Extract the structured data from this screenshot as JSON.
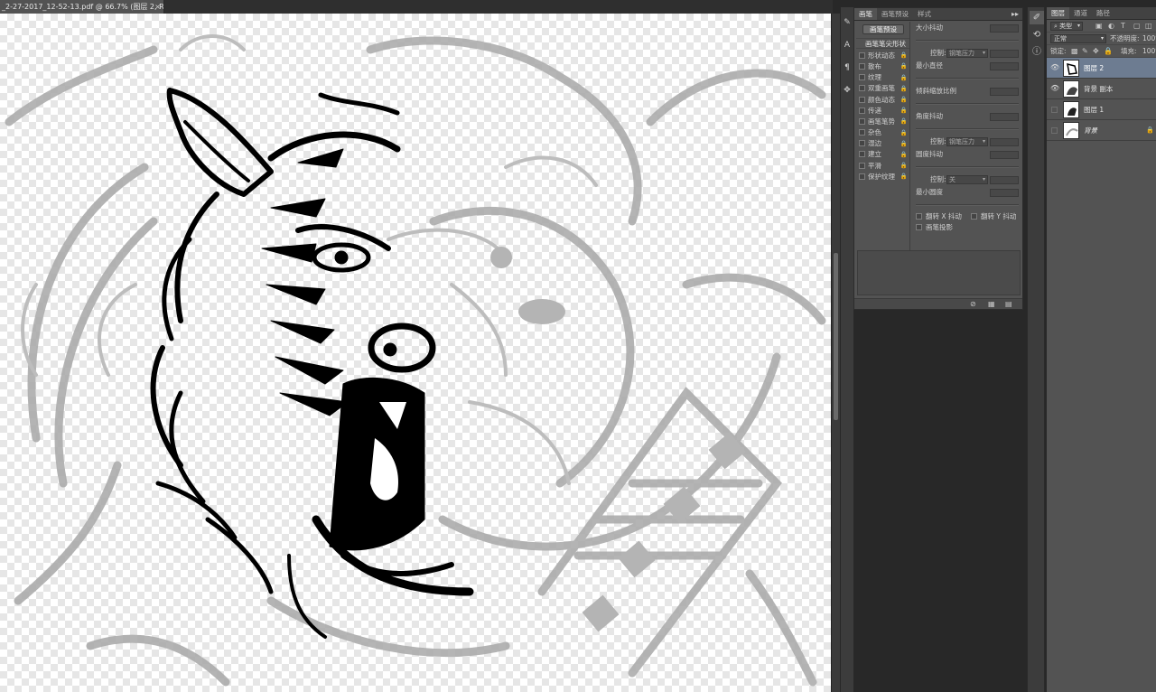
{
  "document": {
    "tab_title": "_2-27-2017_12-52-13.pdf @ 66.7% (图层 2, RGB/8#) *",
    "close_glyph": "×"
  },
  "brush_panel": {
    "tabs": [
      "画笔",
      "画笔预设",
      "样式"
    ],
    "menu_glyph": "▸▸",
    "preset_button": "画笔预设",
    "tip_shape": "画笔笔尖形状",
    "options": [
      "形状动态",
      "散布",
      "纹理",
      "双重画笔",
      "颜色动态",
      "传递",
      "画笔笔势",
      "杂色",
      "湿边",
      "建立",
      "平滑",
      "保护纹理"
    ],
    "size_jitter": "大小抖动",
    "control_label": "控制:",
    "control_pen_pressure": "钢笔压力",
    "control_off": "关",
    "min_diameter": "最小直径",
    "tilt_scale": "倾斜缩放比例",
    "angle_jitter": "角度抖动",
    "roundness_jitter": "圆度抖动",
    "min_roundness": "最小圆度",
    "flip_x": "翻转 X 抖动",
    "flip_y": "翻转 Y 抖动",
    "brush_projection": "画笔投影"
  },
  "layers_panel": {
    "tabs": [
      "图层",
      "通道",
      "路径"
    ],
    "filter_kind": "类型",
    "blend_mode": "正常",
    "opacity_label": "不透明度:",
    "opacity_value": "100%",
    "lock_label": "锁定:",
    "fill_label": "填充:",
    "fill_value": "100%",
    "layers": [
      {
        "name": "图层 2",
        "visible": true,
        "selected": true
      },
      {
        "name": "背景 副本",
        "visible": true,
        "selected": false
      },
      {
        "name": "图层 1",
        "visible": false,
        "selected": false
      },
      {
        "name": "背景",
        "visible": false,
        "selected": false,
        "locked": true
      }
    ]
  },
  "colors": {
    "panel_bg": "#535353",
    "app_bg": "#282828",
    "selected_layer": "#6d7c91",
    "ink": "#000000",
    "sketch": "#a8a8a8"
  }
}
